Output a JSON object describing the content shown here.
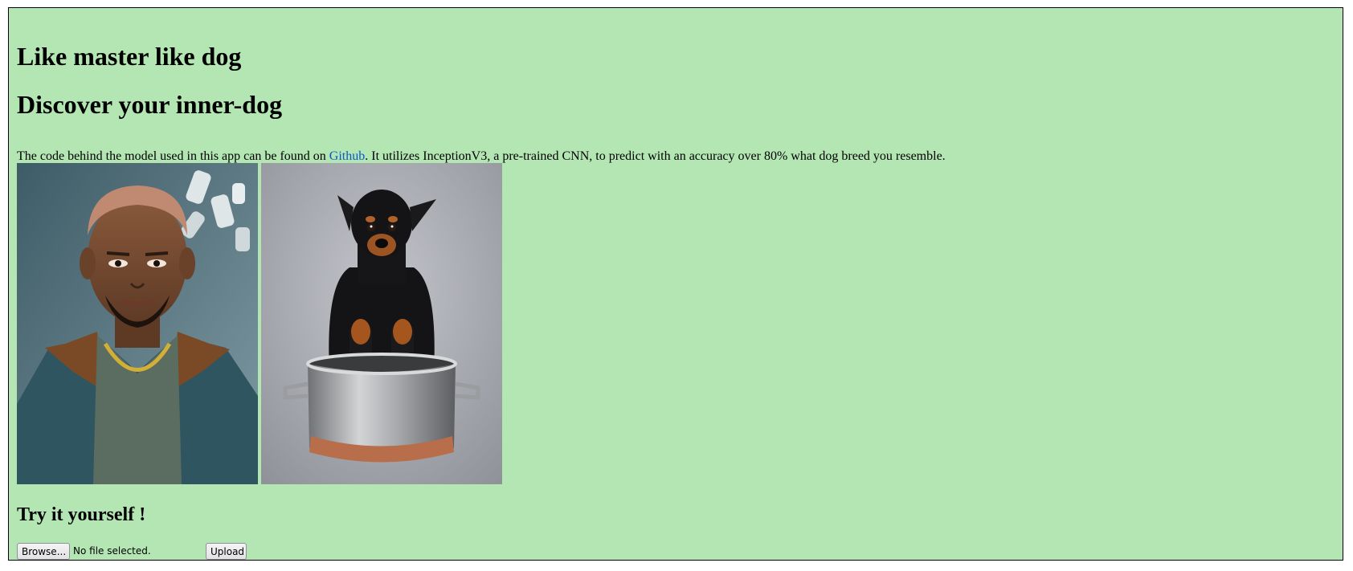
{
  "header": {
    "title": "Like master like dog",
    "subtitle": "Discover your inner-dog"
  },
  "description": {
    "before_link": "The code behind the model used in this app can be found on ",
    "link_text": "Github",
    "after_link": ". It utilizes InceptionV3, a pre-trained CNN, to predict with an accuracy over 80% what dog breed you resemble."
  },
  "photos": {
    "person_icon": "person-portrait-image",
    "dog_icon": "dog-in-pot-image"
  },
  "try_section": {
    "heading": "Try it yourself !",
    "browse_label": "Browse...",
    "file_status": "No file selected.",
    "upload_label": "Upload"
  },
  "colors": {
    "background": "#b3e6b3",
    "link": "#0a58ca"
  }
}
